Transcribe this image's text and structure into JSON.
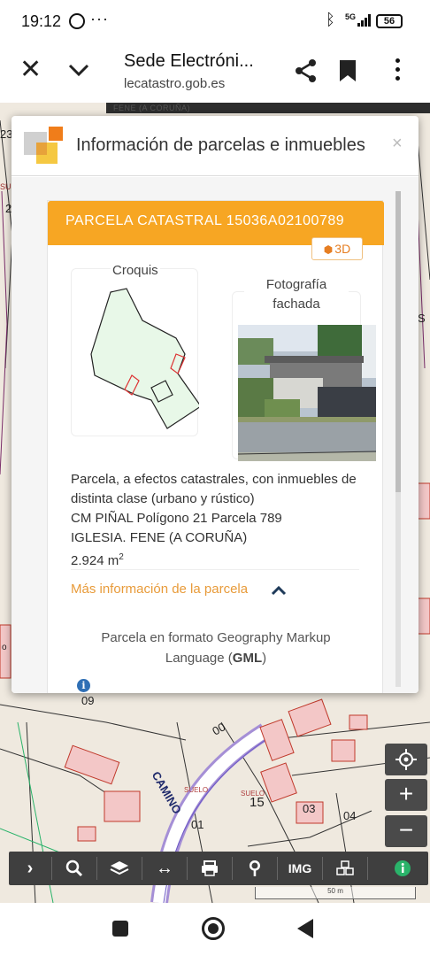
{
  "status_bar": {
    "time": "19:12",
    "icons": [
      "whatsapp-icon",
      "more-dots-icon",
      "bluetooth-icon",
      "5g-signal-icon"
    ],
    "network": "5G",
    "battery": "56"
  },
  "browser": {
    "title": "Sede Electróni...",
    "url": "lecatastro.gob.es",
    "icons": [
      "close-icon",
      "chevron-down-icon",
      "share-icon",
      "bookmark-icon",
      "overflow-menu-icon"
    ]
  },
  "map": {
    "place": "FENE (A CORUÑA)",
    "labels": {
      "camino": "CAMINO",
      "parcel_09": "09",
      "parcel_00": "00",
      "parcel_01": "01",
      "parcel_03": "03",
      "parcel_04": "04",
      "parcel_15": "15",
      "suelo_1": "SUELO",
      "suelo_2": "SUELO",
      "edge_23": "23",
      "edge_2": "2",
      "edge_su": "SU",
      "edge_s": "S",
      "edge_o": "o"
    },
    "controls": [
      "locate-icon",
      "zoom-in-icon",
      "zoom-out-icon"
    ]
  },
  "toolbar": {
    "items": [
      {
        "name": "expand-icon",
        "glyph": ">"
      },
      {
        "name": "search-icon",
        "glyph": "🔍"
      },
      {
        "name": "layers-icon",
        "glyph": "≋"
      },
      {
        "name": "measure-icon",
        "glyph": "↔"
      },
      {
        "name": "print-icon",
        "glyph": "⎙"
      },
      {
        "name": "pin-icon",
        "glyph": "⚲"
      },
      {
        "name": "img-icon",
        "glyph": "IMG"
      },
      {
        "name": "3d-icon",
        "glyph": "▣"
      },
      {
        "name": "info-icon",
        "glyph": "i"
      }
    ],
    "scale": "50 m"
  },
  "dialog": {
    "title": "Información de parcelas e inmuebles",
    "close": "×",
    "parcel": {
      "heading": "PARCELA CATASTRAL 15036A02100789",
      "btn_3d": "3D",
      "croquis_label": "Croquis",
      "photo_label": "Fotografía fachada",
      "description": "Parcela, a efectos catastrales, con inmuebles de distinta clase (urbano y rústico)",
      "address": "CM PIÑAL Polígono 21 Parcela 789",
      "municipality": "IGLESIA. FENE (A CORUÑA)",
      "area": "2.924 m",
      "area_sup": "2",
      "more_info": "Más información de la parcela",
      "gml_text": "Parcela en formato Geography Markup Language (",
      "gml_bold": "GML",
      "gml_end": ")"
    }
  }
}
